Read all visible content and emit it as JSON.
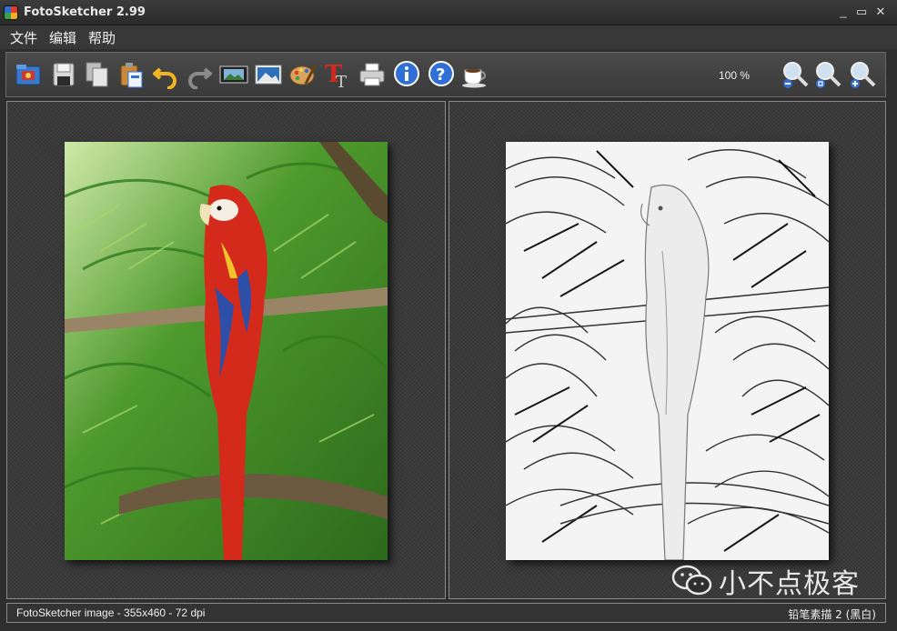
{
  "window": {
    "title": "FotoSketcher 2.99",
    "controls": {
      "minimize": "_",
      "maximize": "▭",
      "close": "✕"
    }
  },
  "menu": {
    "items": [
      {
        "label": "文件"
      },
      {
        "label": "编辑"
      },
      {
        "label": "帮助"
      }
    ]
  },
  "toolbar": {
    "buttons": [
      {
        "icon": "open-folder-icon"
      },
      {
        "icon": "save-icon"
      },
      {
        "icon": "copy-icon"
      },
      {
        "icon": "paste-icon"
      },
      {
        "icon": "undo-icon"
      },
      {
        "icon": "redo-icon"
      },
      {
        "icon": "filmstrip-icon"
      },
      {
        "icon": "landscape-image-icon"
      },
      {
        "icon": "palette-icon"
      },
      {
        "icon": "text-icon"
      },
      {
        "icon": "printer-icon"
      },
      {
        "icon": "info-icon"
      },
      {
        "icon": "help-icon"
      },
      {
        "icon": "coffee-cup-icon"
      }
    ],
    "zoom": "100 %",
    "zoom_buttons": [
      {
        "icon": "zoom-out-icon"
      },
      {
        "icon": "zoom-fit-icon"
      },
      {
        "icon": "zoom-in-icon"
      }
    ]
  },
  "panels": {
    "source_image": "source-parrot-photo",
    "result_image": "pencil-sketch-result"
  },
  "watermark": {
    "icon": "wechat-icon",
    "text": "小不点极客"
  },
  "status": {
    "left": "FotoSketcher image - 355x460 - 72 dpi",
    "right": "铅笔素描 2 (黑白)"
  },
  "colors": {
    "background": "#2e2e2e",
    "panel": "#3a3a3a",
    "border": "#8a8a8a",
    "parrot_red": "#d42a1c",
    "foliage_green": "#3c9a2a"
  }
}
